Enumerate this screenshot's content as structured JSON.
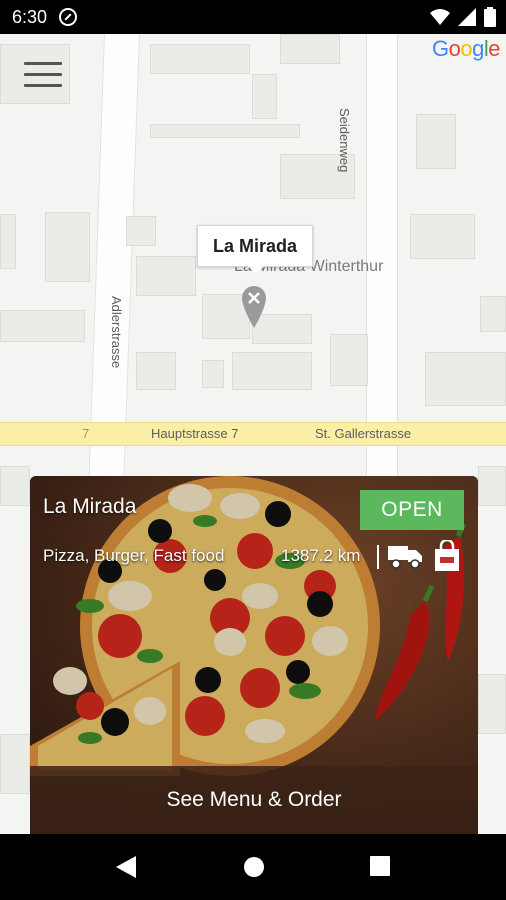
{
  "status_bar": {
    "time": "6:30"
  },
  "map": {
    "google_logo": {
      "G": "G",
      "o1": "o",
      "o2": "o",
      "g": "g",
      "l": "l",
      "e": "e"
    },
    "streets": {
      "seidenweg": "Seidenweg",
      "adlerstrasse": "Adlerstrasse",
      "hauptstrasse": "Hauptstrasse 7",
      "st_gallerstrasse": "St. Gallerstrasse",
      "road_number": "7"
    },
    "marker_callout": "La Mirada",
    "place_label": "La Mirada Winterthur"
  },
  "restaurant_card": {
    "name": "La Mirada",
    "status": "OPEN",
    "categories": "Pizza, Burger, Fast food",
    "distance": "1387.2 km",
    "cta_label": "See Menu & Order",
    "status_color": "#5cb85c",
    "icons": [
      "delivery-truck-icon",
      "shopping-bag-icon"
    ]
  },
  "colors": {
    "main_road": "#fbefa6",
    "status_bar": "#000000",
    "open_badge": "#5cb85c"
  }
}
